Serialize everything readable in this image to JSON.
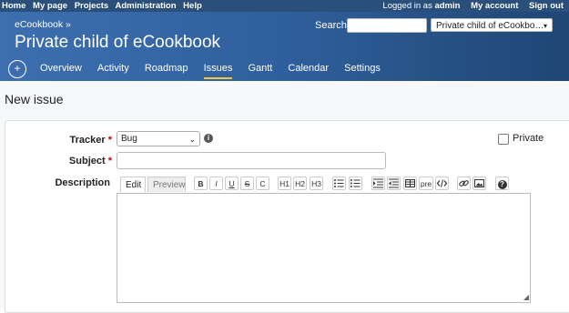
{
  "topbar": {
    "left": [
      "Home",
      "My page",
      "Projects",
      "Administration",
      "Help"
    ],
    "logged_in_label": "Logged in as",
    "user": "admin",
    "my_account": "My account",
    "sign_out": "Sign out"
  },
  "header": {
    "parent": "eCookbook »",
    "title": "Private child of eCookbook",
    "search_label": "Search:",
    "jump_value": "Private child of eCookbo…"
  },
  "menu": {
    "plus": "+",
    "items": [
      "Overview",
      "Activity",
      "Roadmap",
      "Issues",
      "Gantt",
      "Calendar",
      "Settings"
    ],
    "selected": "Issues"
  },
  "page": {
    "title": "New issue"
  },
  "form": {
    "tracker_label": "Tracker",
    "tracker_value": "Bug",
    "subject_label": "Subject",
    "description_label": "Description",
    "required_marker": "*",
    "private_label": "Private",
    "tabs": [
      "Edit",
      "Preview"
    ]
  },
  "toolbar": {
    "bold": "B",
    "italic": "I",
    "underline": "U",
    "strike": "S",
    "code": "C",
    "h1": "H1",
    "h2": "H2",
    "h3": "H3",
    "pre": "pre",
    "help": "?"
  },
  "colors": {
    "topbar": "#2a4f7a",
    "header_start": "#3d6fb0",
    "header_end": "#1f4674",
    "menu_underline": "#f2c744",
    "required": "#cc0000"
  }
}
